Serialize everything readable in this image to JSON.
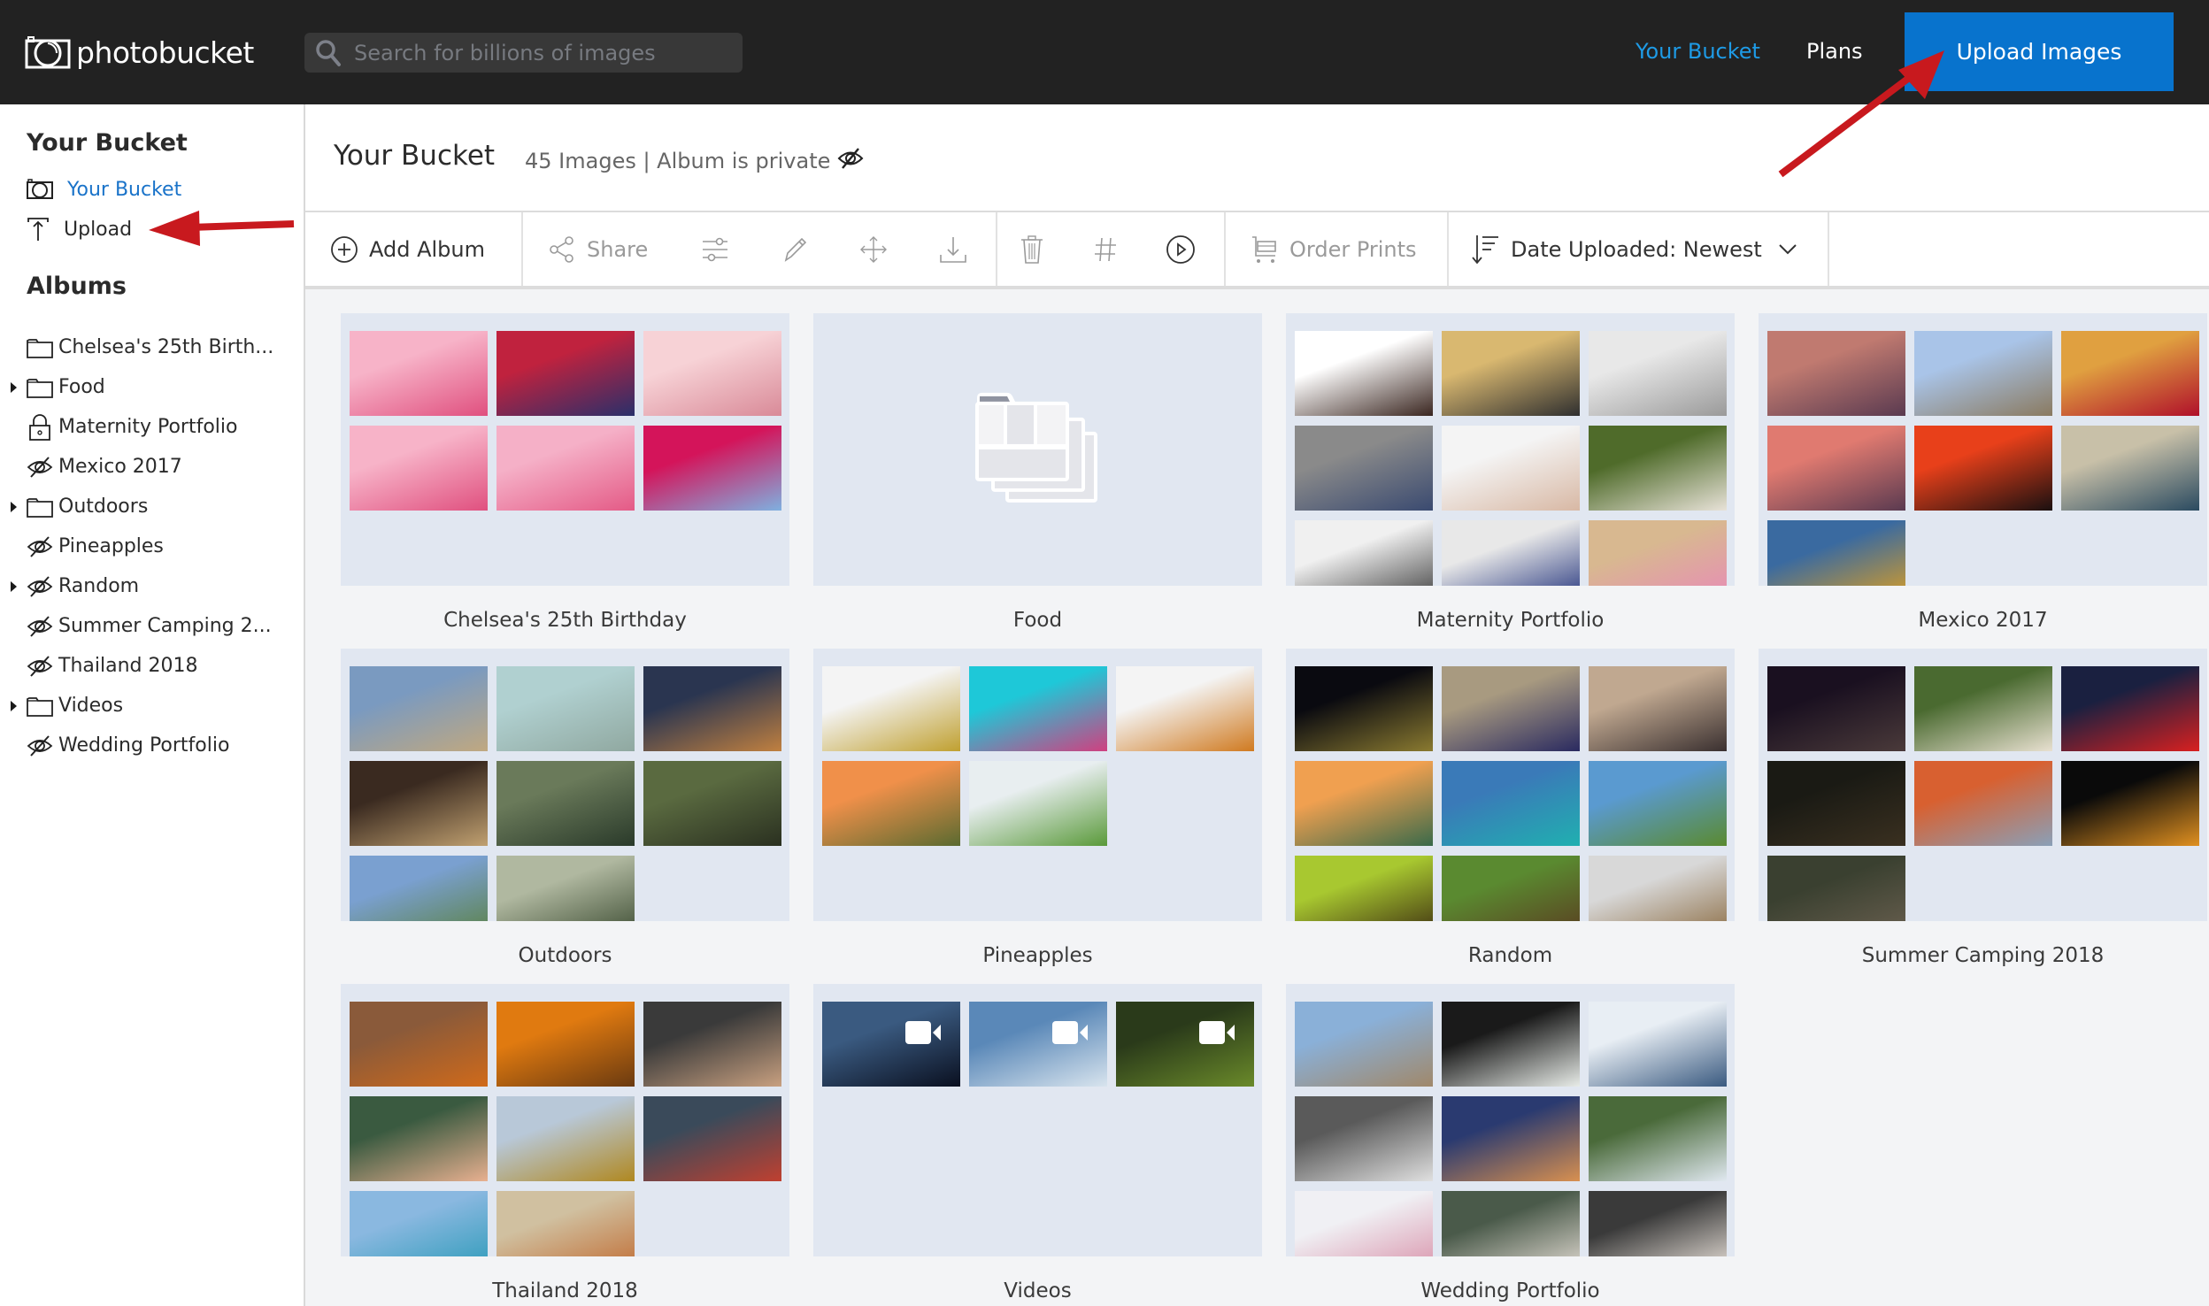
{
  "header": {
    "logo_text": "photobucket",
    "search_placeholder": "Search for billions of images",
    "nav": {
      "your_bucket": "Your Bucket",
      "plans": "Plans"
    },
    "upload_button": "Upload Images",
    "colors": {
      "bar": "#222222",
      "accent_link": "#1e9be6",
      "upload_bg": "#0873cd"
    }
  },
  "sidebar": {
    "your_bucket_heading": "Your Bucket",
    "links": {
      "your_bucket": "Your Bucket",
      "upload": "Upload"
    },
    "albums_heading": "Albums",
    "albums": [
      {
        "label": "Chelsea's 25th Birth...",
        "icon": "folder-icon",
        "expandable": false
      },
      {
        "label": "Food",
        "icon": "folder-icon",
        "expandable": true
      },
      {
        "label": "Maternity Portfolio",
        "icon": "lock-icon",
        "expandable": false
      },
      {
        "label": "Mexico 2017",
        "icon": "eye-slash-icon",
        "expandable": false
      },
      {
        "label": "Outdoors",
        "icon": "folder-icon",
        "expandable": true
      },
      {
        "label": "Pineapples",
        "icon": "eye-slash-icon",
        "expandable": false
      },
      {
        "label": "Random",
        "icon": "eye-slash-icon",
        "expandable": true
      },
      {
        "label": "Summer Camping 2...",
        "icon": "eye-slash-icon",
        "expandable": false
      },
      {
        "label": "Thailand 2018",
        "icon": "eye-slash-icon",
        "expandable": false
      },
      {
        "label": "Videos",
        "icon": "folder-icon",
        "expandable": true
      },
      {
        "label": "Wedding Portfolio",
        "icon": "eye-slash-icon",
        "expandable": false
      }
    ]
  },
  "page": {
    "title": "Your Bucket",
    "meta": "45 Images | Album is private",
    "privacy_icon": "eye-slash-icon"
  },
  "toolbar": {
    "add_album": "Add Album",
    "share": "Share",
    "icons": [
      "adjust-icon",
      "pencil-icon",
      "move-icon",
      "download-icon",
      "trash-icon",
      "hashtag-icon",
      "play-icon"
    ],
    "order_prints": "Order Prints",
    "sort_label": "Date Uploaded: Newest"
  },
  "albums": [
    {
      "name": "Chelsea's 25th Birthday",
      "empty": false,
      "thumbs": [
        {
          "c": [
            "#f7b3c8",
            "#e0507f"
          ]
        },
        {
          "c": [
            "#c0223e",
            "#2a2f6a"
          ]
        },
        {
          "c": [
            "#f7d2d6",
            "#d98a98"
          ]
        },
        {
          "c": [
            "#f7b3c8",
            "#e0507f"
          ]
        },
        {
          "c": [
            "#f5b0c7",
            "#e45a86"
          ]
        },
        {
          "c": [
            "#d4145a",
            "#7fb0e0"
          ]
        }
      ]
    },
    {
      "name": "Food",
      "empty": true,
      "thumbs": []
    },
    {
      "name": "Maternity Portfolio",
      "empty": false,
      "thumbs": [
        {
          "c": [
            "#ffffff",
            "#3a2620"
          ]
        },
        {
          "c": [
            "#d9b870",
            "#2f2f2f"
          ]
        },
        {
          "c": [
            "#e8e8e8",
            "#9a9a9a"
          ]
        },
        {
          "c": [
            "#8a8a8a",
            "#3a4a70"
          ]
        },
        {
          "c": [
            "#f4f4f4",
            "#d8b8a4"
          ]
        },
        {
          "c": [
            "#4f6b2a",
            "#e8e2d8"
          ]
        },
        {
          "c": [
            "#f0f0f0",
            "#3a3a3a"
          ]
        },
        {
          "c": [
            "#e8e8e8",
            "#1e2f7a"
          ]
        },
        {
          "c": [
            "#d8b890",
            "#e88ab8"
          ]
        }
      ]
    },
    {
      "name": "Mexico 2017",
      "empty": false,
      "thumbs": [
        {
          "c": [
            "#c07a70",
            "#5a3a50"
          ]
        },
        {
          "c": [
            "#a9c4e8",
            "#8a7a60"
          ]
        },
        {
          "c": [
            "#e0a040",
            "#b0102a"
          ]
        },
        {
          "c": [
            "#e07a70",
            "#5a3a50"
          ]
        },
        {
          "c": [
            "#e8401a",
            "#1a1010"
          ]
        },
        {
          "c": [
            "#c8c0a8",
            "#2a4a60"
          ]
        },
        {
          "c": [
            "#3a6aa0",
            "#e0a020"
          ]
        }
      ]
    },
    {
      "name": "Outdoors",
      "empty": false,
      "thumbs": [
        {
          "c": [
            "#7a9ac0",
            "#c0a880"
          ]
        },
        {
          "c": [
            "#b0d0d0",
            "#90a8a0"
          ]
        },
        {
          "c": [
            "#2a3550",
            "#c08040"
          ]
        },
        {
          "c": [
            "#3a2a20",
            "#c0a070"
          ]
        },
        {
          "c": [
            "#6a7a5a",
            "#2a3a2a"
          ]
        },
        {
          "c": [
            "#5a6a40",
            "#2a3020"
          ]
        },
        {
          "c": [
            "#7aa0d0",
            "#5a8040"
          ]
        },
        {
          "c": [
            "#b0b8a0",
            "#3a4a30"
          ]
        }
      ]
    },
    {
      "name": "Pineapples",
      "empty": false,
      "thumbs": [
        {
          "c": [
            "#f4f4f4",
            "#c0a030"
          ]
        },
        {
          "c": [
            "#1ec8d8",
            "#d04080"
          ]
        },
        {
          "c": [
            "#f4f4f4",
            "#d07a20"
          ]
        },
        {
          "c": [
            "#f0904a",
            "#5a6a30"
          ]
        },
        {
          "c": [
            "#e8eef0",
            "#5a9a3a"
          ]
        }
      ]
    },
    {
      "name": "Random",
      "empty": false,
      "thumbs": [
        {
          "c": [
            "#0a0a10",
            "#8a7a30"
          ]
        },
        {
          "c": [
            "#a89a80",
            "#2a2a60"
          ]
        },
        {
          "c": [
            "#c0a890",
            "#3a3030"
          ]
        },
        {
          "c": [
            "#f0a050",
            "#3a6a4a"
          ]
        },
        {
          "c": [
            "#3a7ab8",
            "#20b0b0"
          ]
        },
        {
          "c": [
            "#5a9ad0",
            "#5a8a30"
          ]
        },
        {
          "c": [
            "#a8c830",
            "#3a2a10"
          ]
        },
        {
          "c": [
            "#5a8a30",
            "#5a3a20"
          ]
        },
        {
          "c": [
            "#d8d8d8",
            "#8a6a40"
          ]
        }
      ]
    },
    {
      "name": "Summer Camping 2018",
      "empty": false,
      "thumbs": [
        {
          "c": [
            "#1a1020",
            "#4a3a3a"
          ]
        },
        {
          "c": [
            "#4a6a30",
            "#e8e0d0"
          ]
        },
        {
          "c": [
            "#1a2040",
            "#d82020"
          ]
        },
        {
          "c": [
            "#1a1a14",
            "#3a3020"
          ]
        },
        {
          "c": [
            "#d86030",
            "#8aa0b8"
          ]
        },
        {
          "c": [
            "#0a0a0a",
            "#e09020"
          ]
        },
        {
          "c": [
            "#3a4030",
            "#6a6050"
          ]
        }
      ]
    },
    {
      "name": "Thailand 2018",
      "empty": false,
      "thumbs": [
        {
          "c": [
            "#8a5a3a",
            "#d06a1a"
          ]
        },
        {
          "c": [
            "#e07a10",
            "#6a3a10"
          ]
        },
        {
          "c": [
            "#3a3a3a",
            "#c8a080"
          ]
        },
        {
          "c": [
            "#3a5a40",
            "#e8b090"
          ]
        },
        {
          "c": [
            "#b8c8d8",
            "#b08820"
          ]
        },
        {
          "c": [
            "#3a4a5a",
            "#c04030"
          ]
        },
        {
          "c": [
            "#8ab8e0",
            "#2a9ab8"
          ]
        },
        {
          "c": [
            "#d0c0a0",
            "#c06a30"
          ]
        }
      ]
    },
    {
      "name": "Videos",
      "empty": false,
      "video": true,
      "thumbs": [
        {
          "c": [
            "#3a5a80",
            "#0a1020"
          ]
        },
        {
          "c": [
            "#5a88b8",
            "#d8e4ee"
          ]
        },
        {
          "c": [
            "#2a3a1a",
            "#6a8a2a"
          ]
        }
      ]
    },
    {
      "name": "Wedding Portfolio",
      "empty": false,
      "thumbs": [
        {
          "c": [
            "#8ab0d8",
            "#a0886a"
          ]
        },
        {
          "c": [
            "#1a1a1a",
            "#e8ece8"
          ]
        },
        {
          "c": [
            "#e8eef4",
            "#3a5a80"
          ]
        },
        {
          "c": [
            "#5a5a5a",
            "#e0e0e0"
          ]
        },
        {
          "c": [
            "#2a3a70",
            "#d89050"
          ]
        },
        {
          "c": [
            "#4a6a3a",
            "#e0e8f0"
          ]
        },
        {
          "c": [
            "#f0f0f4",
            "#d890a8"
          ]
        },
        {
          "c": [
            "#4a5a4a",
            "#e8e0d8"
          ]
        },
        {
          "c": [
            "#3a3a3a",
            "#f0e8e0"
          ]
        }
      ]
    }
  ],
  "annotations": {
    "arrow_color": "#c8191e"
  }
}
